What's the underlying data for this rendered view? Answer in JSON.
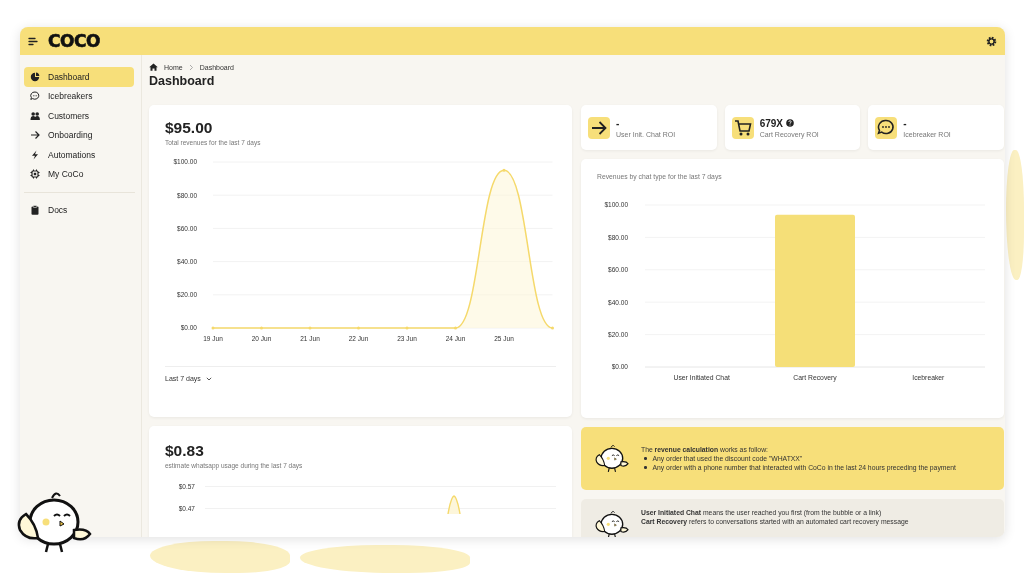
{
  "header": {
    "logo": "COCO"
  },
  "sidebar": {
    "items": [
      {
        "label": "Dashboard",
        "selected": true
      },
      {
        "label": "Icebreakers",
        "selected": false
      },
      {
        "label": "Customers",
        "selected": false
      },
      {
        "label": "Onboarding",
        "selected": false
      },
      {
        "label": "Automations",
        "selected": false
      },
      {
        "label": "My CoCo",
        "selected": false
      }
    ],
    "footer_items": [
      {
        "label": "Docs",
        "selected": false
      }
    ]
  },
  "breadcrumb": [
    "Home",
    "Dashboard"
  ],
  "page_title": "Dashboard",
  "revenue_card": {
    "value": "$95.00",
    "subtitle": "Total revenues for the last 7 days",
    "range_selector": "Last 7 days",
    "chart_data": {
      "type": "line",
      "categories": [
        "19 Jun",
        "20 Jun",
        "21 Jun",
        "22 Jun",
        "23 Jun",
        "24 Jun",
        "25 Jun",
        null
      ],
      "ylim": [
        0,
        100
      ],
      "grid": true,
      "yticks": [
        {
          "value": 0,
          "label": "$0.00"
        },
        {
          "value": 20,
          "label": "$20.00"
        },
        {
          "value": 40,
          "label": "$40.00"
        },
        {
          "value": 60,
          "label": "$60.00"
        },
        {
          "value": 80,
          "label": "$80.00"
        },
        {
          "value": 100,
          "label": "$100.00"
        }
      ],
      "series": [
        {
          "color": "#f5d96b",
          "values": [
            0,
            0,
            0,
            0,
            0,
            0,
            95,
            0
          ]
        }
      ]
    }
  },
  "roi_cards": [
    {
      "value": "-",
      "label": "User Init. Chat ROI",
      "info": false
    },
    {
      "value": "679X",
      "label": "Cart Recovery ROI",
      "info": true
    },
    {
      "value": "-",
      "label": "Icebreaker ROI",
      "info": false
    }
  ],
  "chat_type_card": {
    "title": "Revenues by chat type for the last 7 days",
    "chart_data": {
      "type": "bar",
      "grid": true,
      "categories": [
        "User Initiated Chat",
        "Cart Recovery",
        "Icebreaker"
      ],
      "ylim": [
        0,
        100
      ],
      "yticks": [
        {
          "value": 0,
          "label": "$0.00"
        },
        {
          "value": 20,
          "label": "$20.00"
        },
        {
          "value": 40,
          "label": "$40.00"
        },
        {
          "value": 60,
          "label": "$60.00"
        },
        {
          "value": 80,
          "label": "$80.00"
        },
        {
          "value": 100,
          "label": "$100.00"
        }
      ],
      "series": [
        {
          "color": "#f5df78",
          "values": [
            0,
            94,
            0
          ]
        }
      ]
    }
  },
  "usage_card": {
    "value": "$0.83",
    "subtitle": "estimate whatsapp usage during the last 7 days",
    "y_tick_labels": [
      "$0.57",
      "$0.47"
    ]
  },
  "notes": [
    {
      "kind": "highlight",
      "lines": [
        "The **revenue calculation** works as follow:"
      ],
      "bullets": [
        "Any order that used the discount code \"WHATXX\"",
        "Any order with a phone number that interacted with CoCo in the last 24 hours preceding the payment"
      ]
    },
    {
      "kind": "plain",
      "lines": [
        "**User Initiated Chat** means the user reached you first (from the bubble or a link)",
        "**Cart Recovery** refers to conversations started with an automated cart recovery message"
      ]
    }
  ]
}
